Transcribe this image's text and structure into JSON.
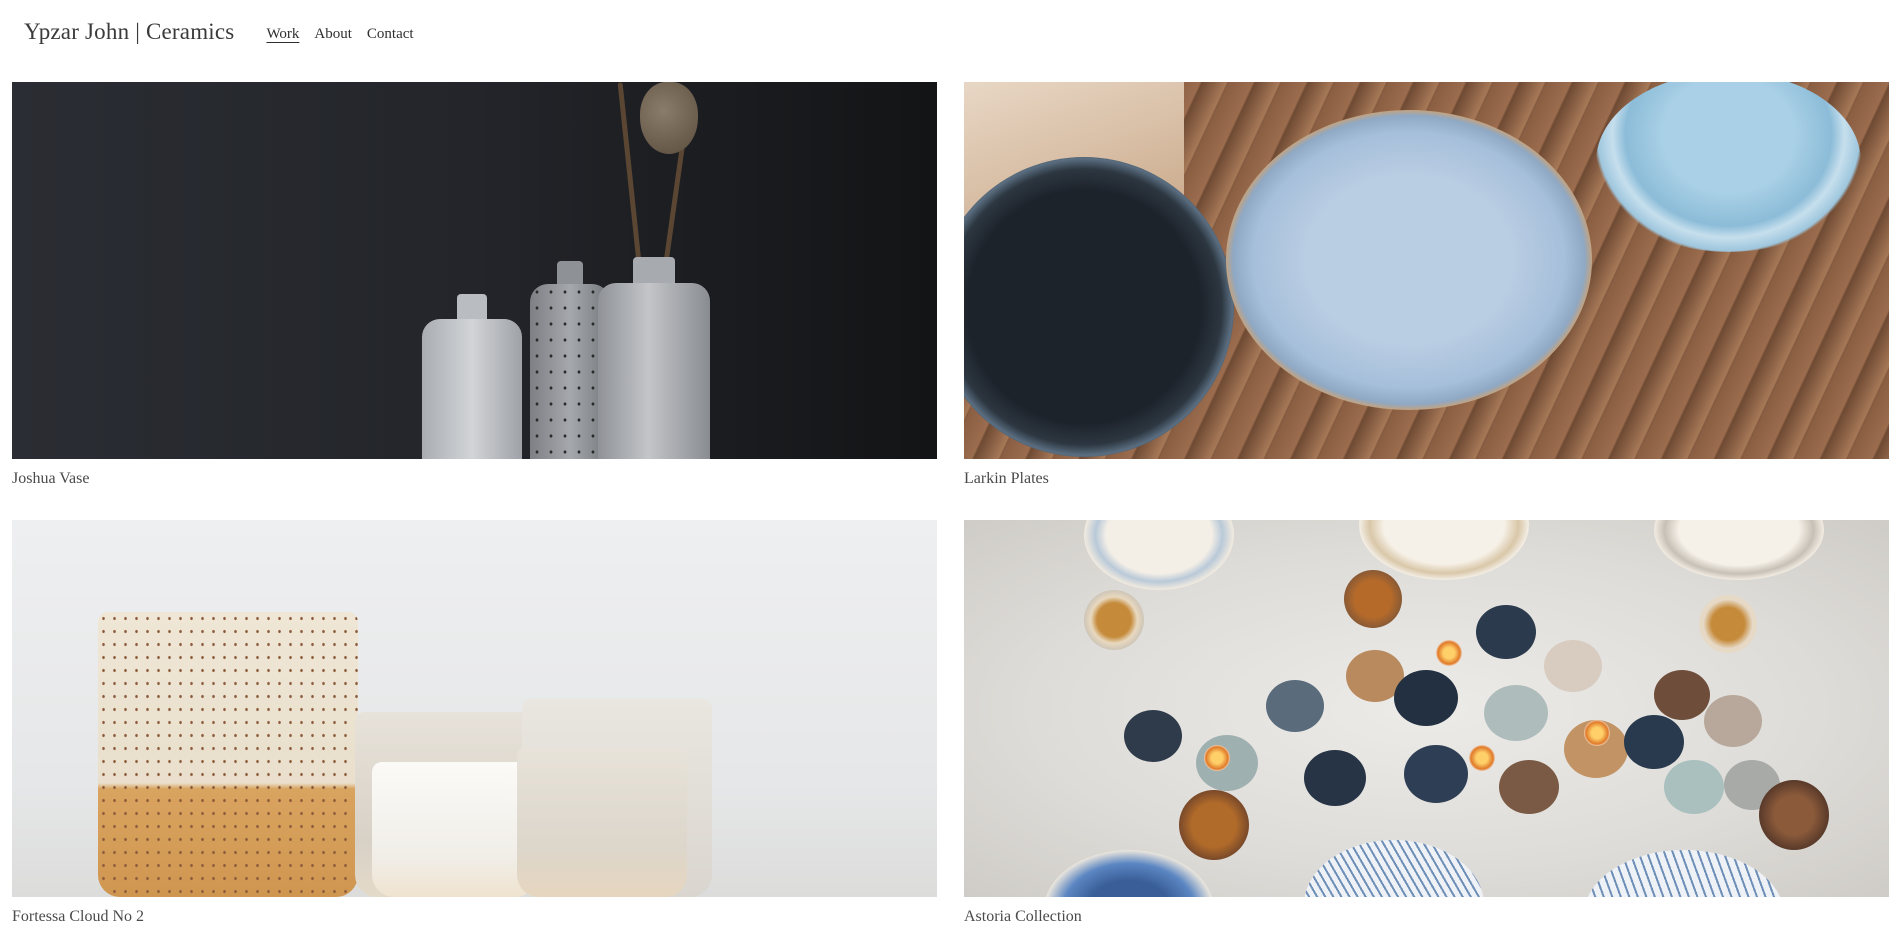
{
  "header": {
    "site_title": "Ypzar John | Ceramics",
    "nav": [
      {
        "label": "Work",
        "active": true
      },
      {
        "label": "About",
        "active": false
      },
      {
        "label": "Contact",
        "active": false
      }
    ]
  },
  "projects": [
    {
      "title": "Joshua Vase"
    },
    {
      "title": "Larkin Plates"
    },
    {
      "title": "Fortessa Cloud No 2"
    },
    {
      "title": "Astoria Collection"
    }
  ]
}
